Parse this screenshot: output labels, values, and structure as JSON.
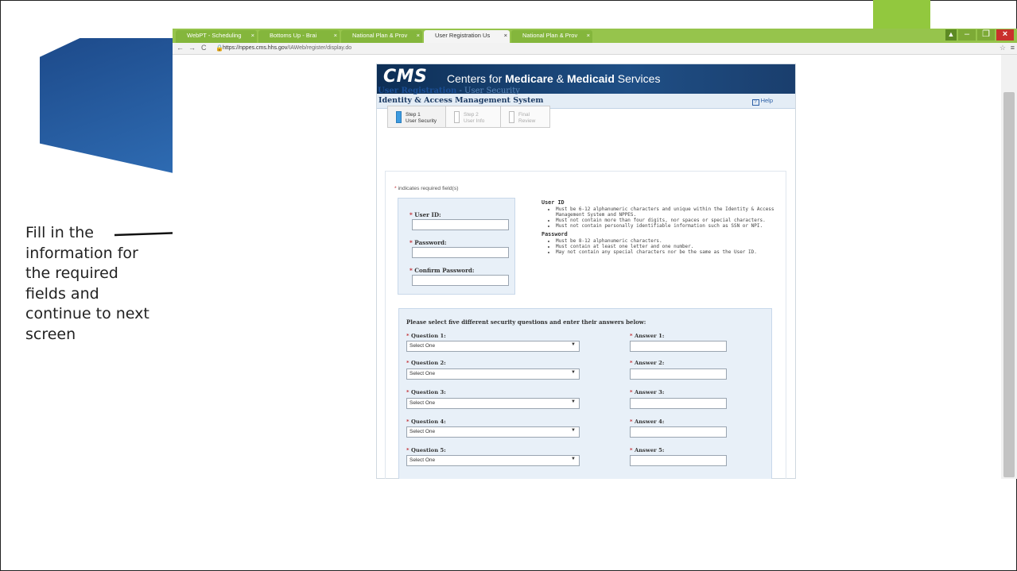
{
  "slide": {
    "caption": "Fill in the information for the required fields and continue to next screen"
  },
  "browser": {
    "tabs": [
      {
        "label": "WebPT - Scheduling",
        "active": false
      },
      {
        "label": "Bottoms Up - Brai",
        "active": false
      },
      {
        "label": "National Plan & Prov",
        "active": false
      },
      {
        "label": "User Registration Us",
        "active": true
      },
      {
        "label": "National Plan & Prov",
        "active": false
      }
    ],
    "tab_close": "×",
    "url_host": "https://nppes.cms.hhs.gov",
    "url_path": "/IAWeb/register/display.do",
    "window_buttons": {
      "user": "▲",
      "minimize": "–",
      "restore": "❐",
      "close": "×"
    },
    "nav": {
      "back": "←",
      "forward": "→",
      "reload": "C",
      "lock": "🔒",
      "star": "☆",
      "menu": "≡"
    }
  },
  "cms": {
    "logo": "CMS",
    "tagline_pre": "Centers for ",
    "tagline_bold1": "Medicare",
    "tagline_mid": " & ",
    "tagline_bold2": "Medicaid",
    "tagline_post": " Services",
    "system_title": "Identity & Access Management System",
    "help_label": "Help",
    "help_icon": "?",
    "page_title": "User Registration",
    "page_subtitle": " - User Security"
  },
  "steps": [
    {
      "line1": "Step 1",
      "line2": "User Security",
      "active": true
    },
    {
      "line1": "Step 2",
      "line2": "User Info",
      "active": false
    },
    {
      "line1": "Final",
      "line2": "Review",
      "active": false
    }
  ],
  "form": {
    "required_star": "*",
    "required_note": " indicates required field(s)",
    "user_id_label": "User ID:",
    "password_label": "Password:",
    "confirm_password_label": "Confirm Password:",
    "user_id_value": "",
    "password_value": "",
    "confirm_password_value": ""
  },
  "rules": {
    "user_id_heading": "User ID",
    "user_id_rules": [
      "Must be 6-12 alphanumeric characters and unique within the Identity & Access Management System and NPPES.",
      "Must not contain more than four digits, nor spaces or special characters.",
      "Must not contain personally identifiable information such as SSN or NPI."
    ],
    "password_heading": "Password",
    "password_rules": [
      "Must be 8-12 alphanumeric characters.",
      "Must contain at least one letter and one number.",
      "May not contain any special characters nor be the same as the User ID."
    ]
  },
  "security": {
    "heading": "Please select five different security questions and enter their answers below:",
    "questions": [
      {
        "label": "Question 1:",
        "answer_label": "Answer 1:",
        "selected": "Select One"
      },
      {
        "label": "Question 2:",
        "answer_label": "Answer 2:",
        "selected": "Select One"
      },
      {
        "label": "Question 3:",
        "answer_label": "Answer 3:",
        "selected": "Select One"
      },
      {
        "label": "Question 4:",
        "answer_label": "Answer 4:",
        "selected": "Select One"
      },
      {
        "label": "Question 5:",
        "answer_label": "Answer 5:",
        "selected": "Select One"
      }
    ],
    "dropdown_arrow": "▼"
  },
  "colors": {
    "accent_green": "#92c83e",
    "slide_blue": "#2e6bb2",
    "cms_navy": "#0d2e55",
    "required_red": "#c0272d"
  }
}
